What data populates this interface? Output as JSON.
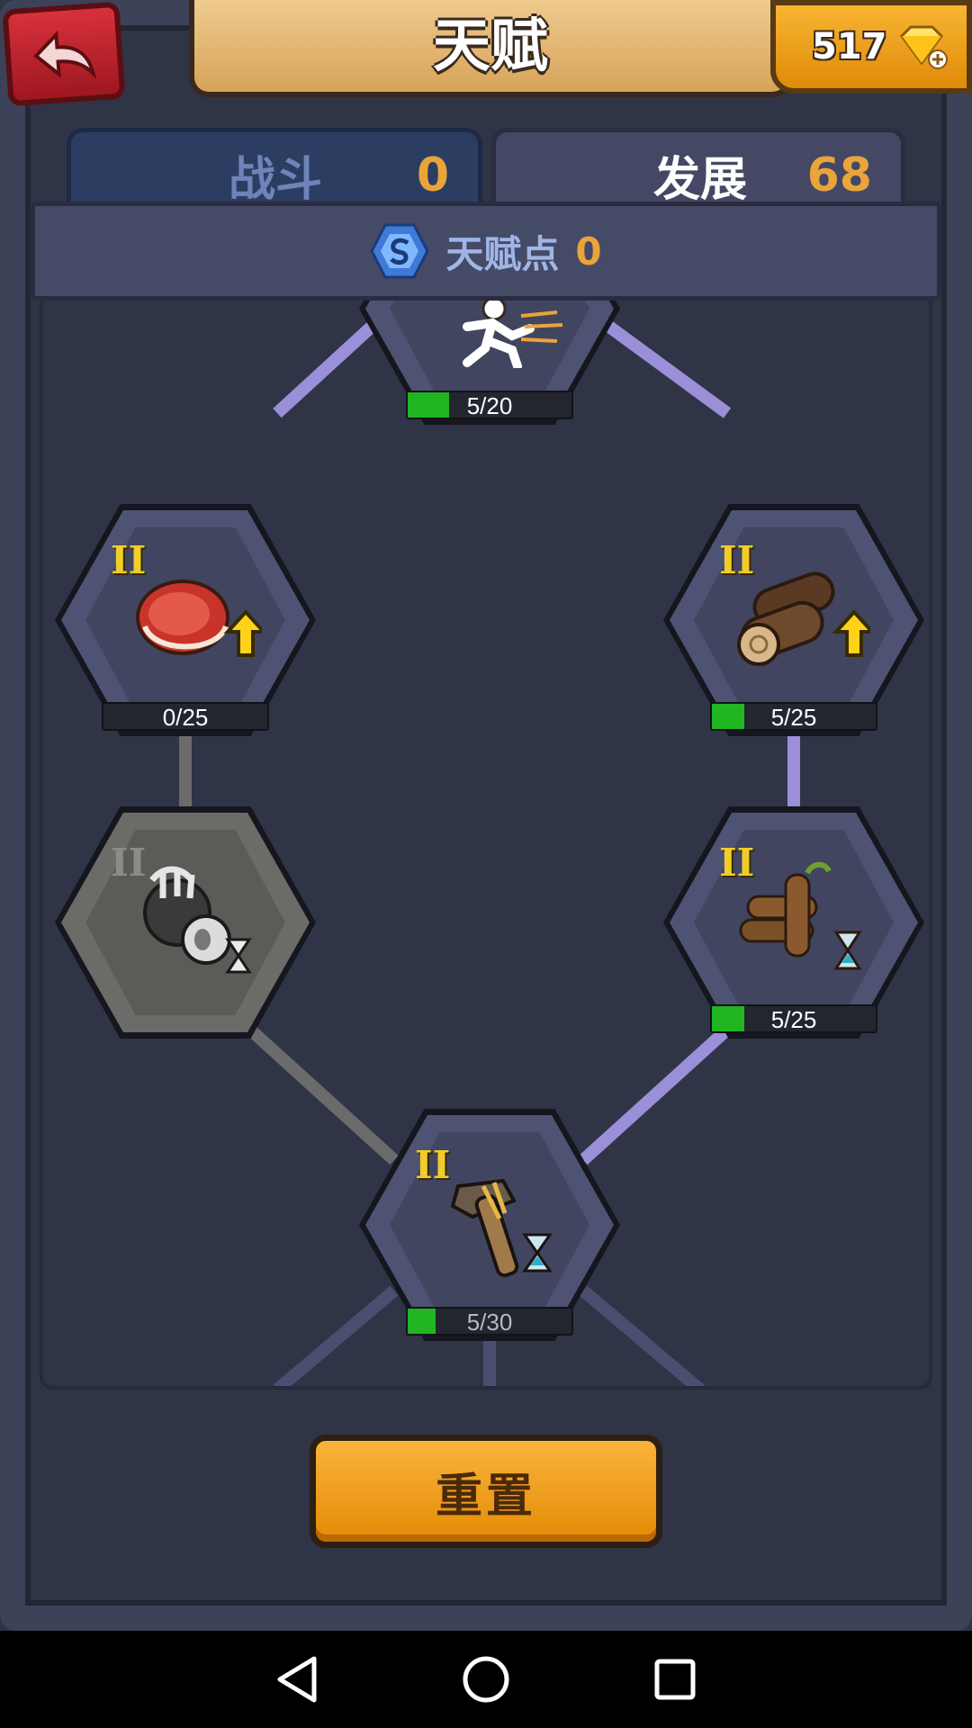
{
  "header": {
    "title": "天赋",
    "gem_count": "517"
  },
  "tabs": [
    {
      "label": "战斗",
      "count": "0",
      "active": false
    },
    {
      "label": "发展",
      "count": "68",
      "active": true
    }
  ],
  "talent_points": {
    "label": "天赋点",
    "value": "0"
  },
  "nodes": [
    {
      "id": "speed",
      "rank": "",
      "progress_text": "5/20",
      "progress": 0.25,
      "icon": "running-man-icon",
      "locked": false
    },
    {
      "id": "meat",
      "rank": "II",
      "progress_text": "0/25",
      "progress": 0,
      "icon": "meat-upgrade-icon",
      "locked": false
    },
    {
      "id": "wood",
      "rank": "II",
      "progress_text": "5/25",
      "progress": 0.2,
      "icon": "logs-upgrade-icon",
      "locked": false
    },
    {
      "id": "trap",
      "rank": "II",
      "progress_text": "",
      "progress": 0,
      "icon": "trap-timer-icon",
      "locked": true
    },
    {
      "id": "woodpile",
      "rank": "II",
      "progress_text": "5/25",
      "progress": 0.2,
      "icon": "woodpile-timer-icon",
      "locked": false
    },
    {
      "id": "hammer",
      "rank": "II",
      "progress_text": "5/30",
      "progress": 0.17,
      "icon": "stone-hammer-timer-icon",
      "locked": false
    }
  ],
  "reset_label": "重置",
  "colors": {
    "accent": "#e9a43a",
    "progress": "#21b522",
    "link_active": "#9a8fd8",
    "link_inactive": "#6b6b6b"
  }
}
